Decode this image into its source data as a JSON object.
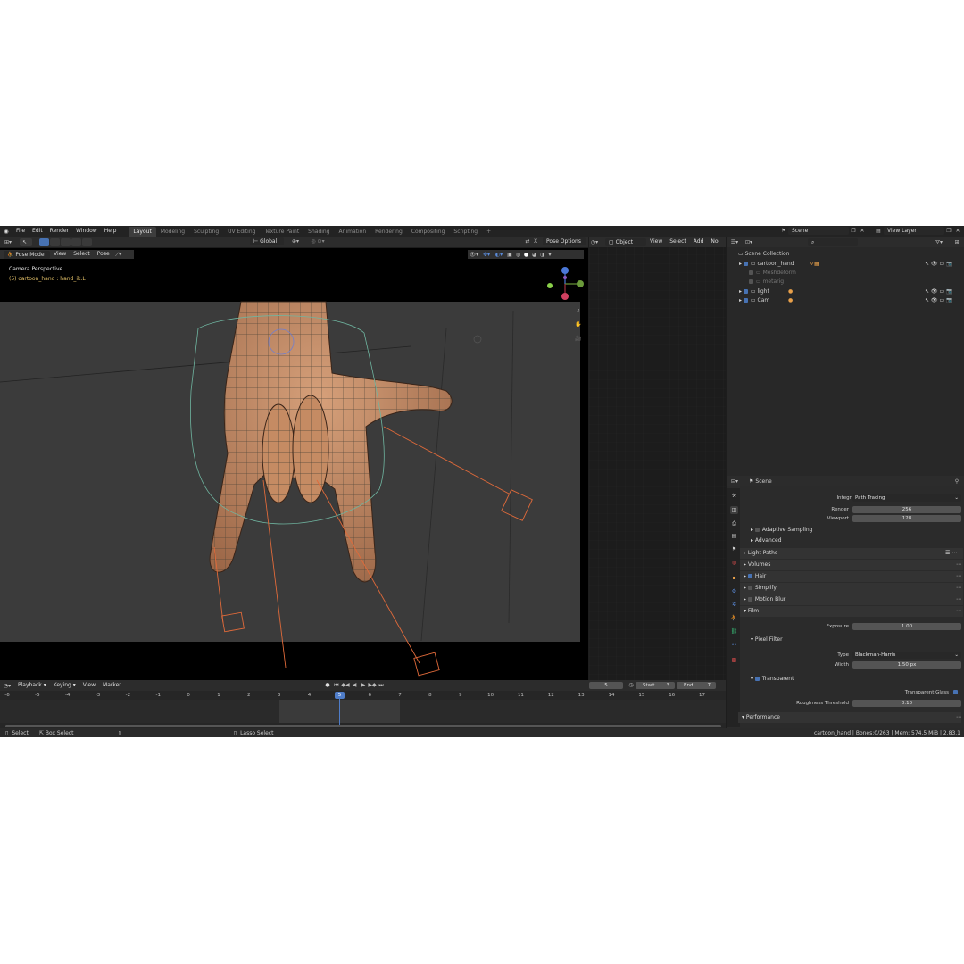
{
  "menu": [
    "File",
    "Edit",
    "Render",
    "Window",
    "Help"
  ],
  "workspaces": [
    "Layout",
    "Modeling",
    "Sculpting",
    "UV Editing",
    "Texture Paint",
    "Shading",
    "Animation",
    "Rendering",
    "Compositing",
    "Scripting",
    "+"
  ],
  "scene_name": "Scene",
  "view_layer": "View Layer",
  "viewport": {
    "mode": "Pose Mode",
    "menus": [
      "View",
      "Select",
      "Pose"
    ],
    "transform_orientation": "Global",
    "pose_options": "Pose Options",
    "overlay_title": "Camera Perspective",
    "overlay_subtitle": "(5) cartoon_hand : hand_ik.L"
  },
  "node_editor": {
    "type": "Object",
    "menus": [
      "View",
      "Select",
      "Add",
      "Node"
    ]
  },
  "outliner": {
    "root": "Scene Collection",
    "items": [
      {
        "name": "cartoon_hand",
        "checked": true,
        "dim": false
      },
      {
        "name": "Meshdeform",
        "checked": false,
        "dim": true
      },
      {
        "name": "metarig",
        "checked": false,
        "dim": true
      },
      {
        "name": "light",
        "checked": true,
        "dim": false
      },
      {
        "name": "Cam",
        "checked": true,
        "dim": false
      }
    ]
  },
  "properties": {
    "context": "Scene",
    "integrator_label": "Integrator",
    "integrator_value": "Path Tracing",
    "render_label": "Render",
    "render_value": "256",
    "viewport_label": "Viewport",
    "viewport_value": "128",
    "adaptive_sampling": "Adaptive Sampling",
    "advanced": "Advanced",
    "light_paths": "Light Paths",
    "volumes": "Volumes",
    "hair": "Hair",
    "simplify": "Simplify",
    "motion_blur": "Motion Blur",
    "film": "Film",
    "exposure_label": "Exposure",
    "exposure_value": "1.00",
    "pixel_filter": "Pixel Filter",
    "type_label": "Type",
    "type_value": "Blackman-Harris",
    "width_label": "Width",
    "width_value": "1.50 px",
    "transparent": "Transparent",
    "transparent_glass": "Transparent Glass",
    "roughness_label": "Roughness Threshold",
    "roughness_value": "0.10",
    "performance": "Performance"
  },
  "timeline": {
    "menus": [
      "Playback",
      "Keying",
      "View",
      "Marker"
    ],
    "current_frame": "5",
    "start_label": "Start",
    "start_value": "3",
    "end_label": "End",
    "end_value": "7",
    "ticks": [
      "-6",
      "-5",
      "-4",
      "-3",
      "-2",
      "-1",
      "0",
      "1",
      "2",
      "3",
      "4",
      "5",
      "6",
      "7",
      "8",
      "9",
      "10",
      "11",
      "12",
      "13",
      "14",
      "15",
      "16",
      "17"
    ]
  },
  "statusbar": {
    "select": "Select",
    "box_select": "Box Select",
    "lasso_select": "Lasso Select",
    "info": "cartoon_hand | Bones:0/263 | Mem: 574.5 MiB | 2.83.1"
  },
  "colors": {
    "accent": "#4772b3",
    "active_frame": "#4f7dc9",
    "bone_line": "#e06a3a",
    "skin": "#c98d66"
  }
}
